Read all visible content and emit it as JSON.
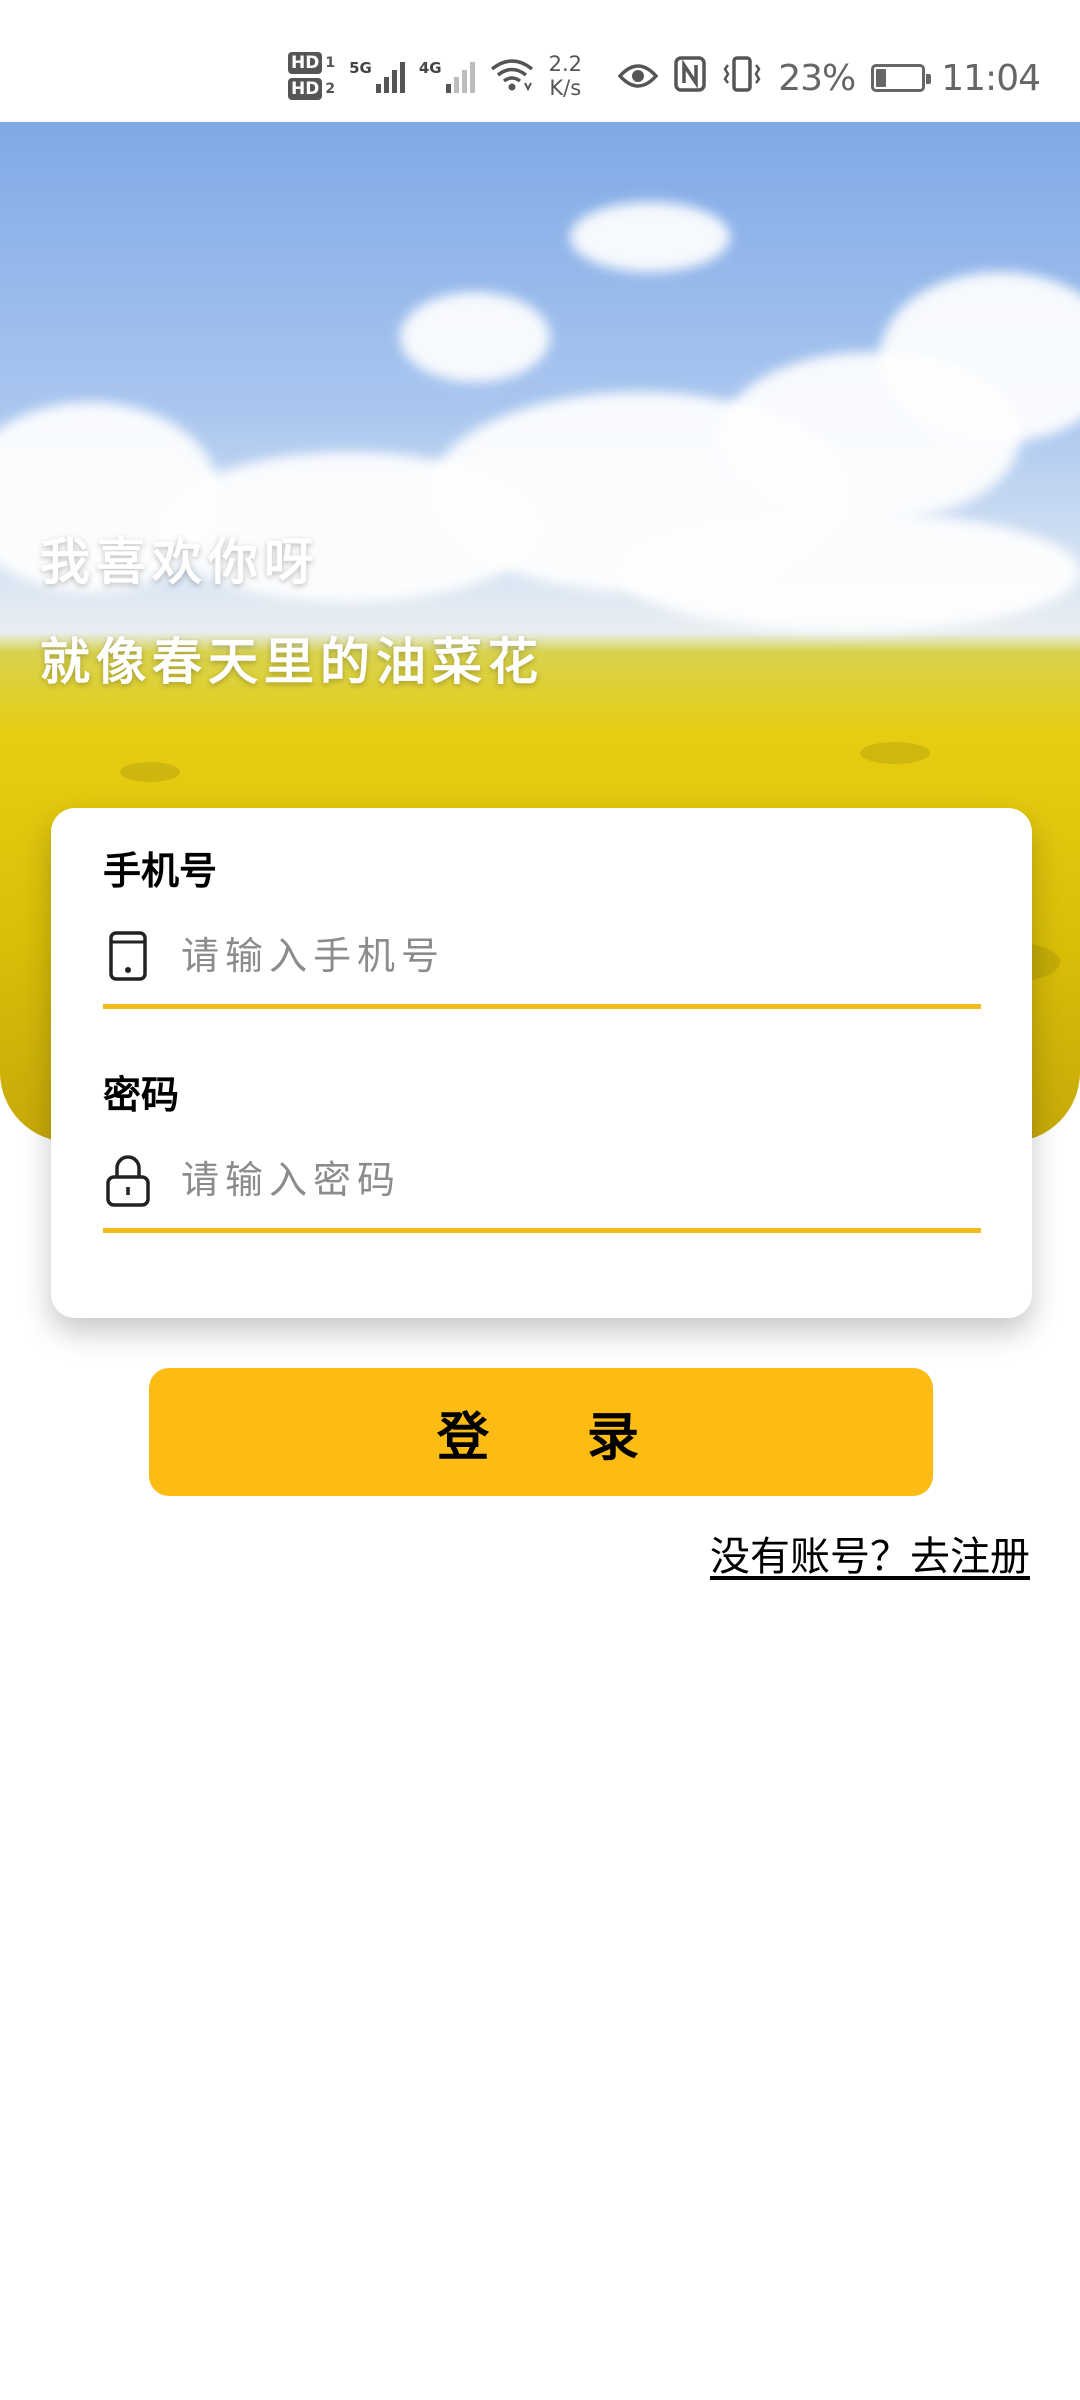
{
  "status_bar": {
    "sim1": "HD",
    "sim1_num": "1",
    "sim2": "HD",
    "sim2_num": "2",
    "net1": "5G",
    "net2": "4G",
    "speed_value": "2.2",
    "speed_unit": "K/s",
    "battery_percent_text": "23%",
    "battery_level": 0.23,
    "time": "11:04"
  },
  "hero": {
    "line1": "我喜欢你呀",
    "line2": "就像春天里的油菜花"
  },
  "form": {
    "phone_label": "手机号",
    "phone_placeholder": "请输入手机号",
    "phone_value": "",
    "password_label": "密码",
    "password_placeholder": "请输入密码",
    "password_value": ""
  },
  "actions": {
    "login_label": "登 录",
    "register_link": "没有账号？去注册"
  },
  "colors": {
    "accent": "#fdbc13",
    "underline": "#f3bc1c"
  }
}
